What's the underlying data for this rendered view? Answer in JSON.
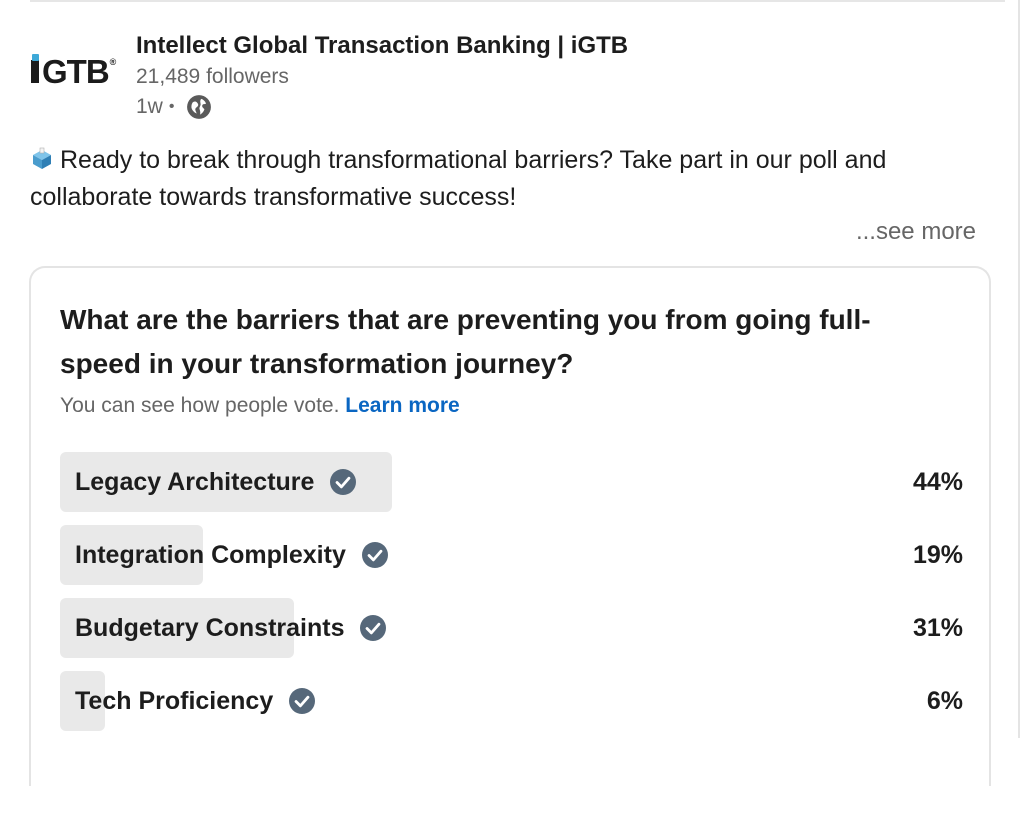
{
  "post": {
    "company_name": "Intellect Global Transaction Banking | iGTB",
    "followers": "21,489 followers",
    "timestamp": "1w",
    "separator": "•",
    "visibility_icon": "globe-icon",
    "logo_text": "iGTB",
    "logo_registered": "®",
    "logo_accent_color": "#3da9d8",
    "body_icon": "ballot-box-icon",
    "body_text": "Ready to break through transformational barriers? Take part in our poll and collaborate towards transformative success!",
    "see_more": "...see more"
  },
  "poll": {
    "question": "What are the barriers that are preventing you from going full-speed in your transformation journey?",
    "note": "You can see how people vote.",
    "learn_more": "Learn more",
    "learn_more_color": "#0a66c2",
    "options": [
      {
        "label": "Legacy Architecture",
        "percent_text": "44%",
        "fraction": 0.44,
        "voted_icon": "check-circle-icon"
      },
      {
        "label": "Integration Complexity",
        "percent_text": "19%",
        "fraction": 0.19,
        "voted_icon": "check-circle-icon"
      },
      {
        "label": "Budgetary Constraints",
        "percent_text": "31%",
        "fraction": 0.31,
        "voted_icon": "check-circle-icon"
      },
      {
        "label": "Tech Proficiency",
        "percent_text": "6%",
        "fraction": 0.06,
        "voted_icon": "check-circle-icon"
      }
    ]
  }
}
